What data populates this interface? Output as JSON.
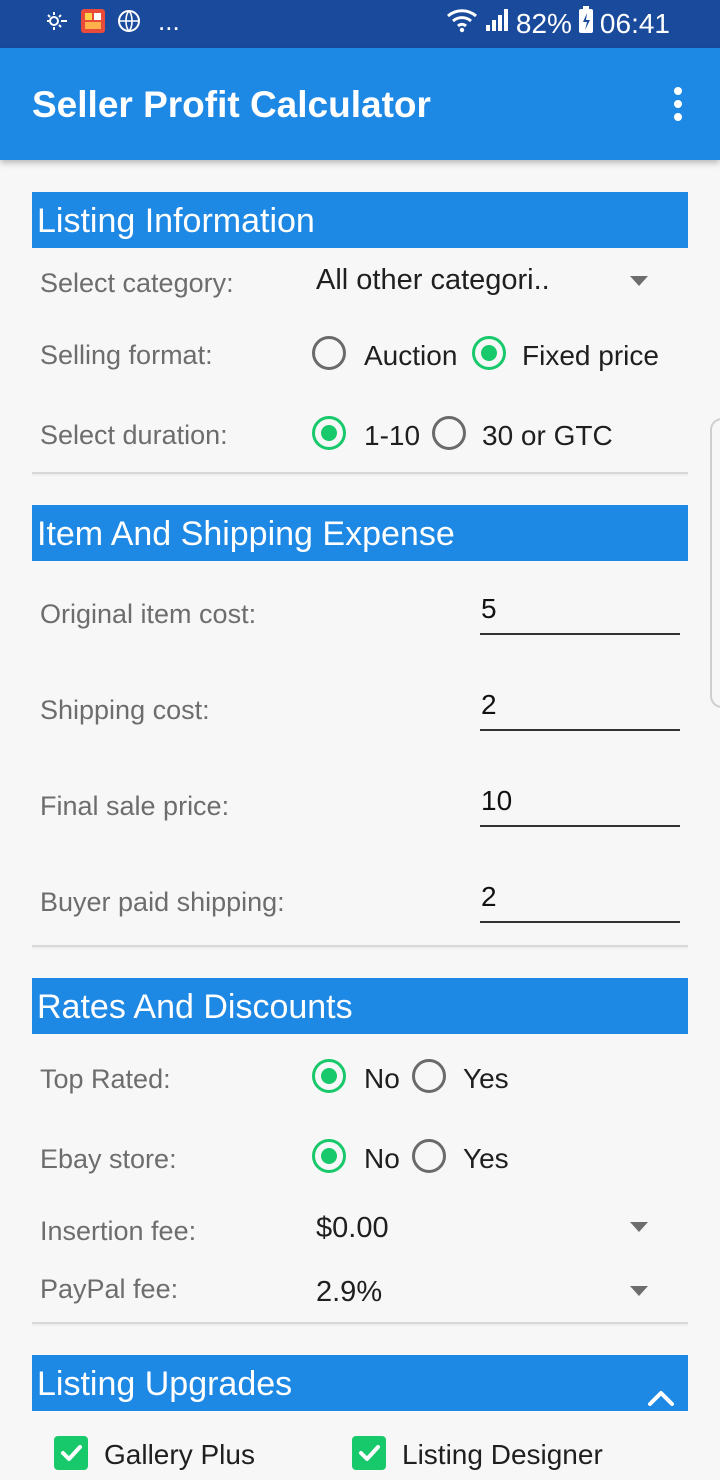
{
  "status_bar": {
    "left_icons": [
      "weather-icon",
      "gallery-icon",
      "globe-icon"
    ],
    "ellipsis": "...",
    "battery": "82%",
    "time": "06:41"
  },
  "app_bar": {
    "title": "Seller Profit Calculator",
    "menu_icon": "more-vert-icon"
  },
  "listing_info": {
    "header": "Listing Information",
    "category_label": "Select category:",
    "category_value": "All other categori..",
    "format_label": "Selling format:",
    "format_options": [
      "Auction",
      "Fixed price"
    ],
    "format_selected": "Fixed price",
    "duration_label": "Select duration:",
    "duration_options": [
      "1-10",
      "30 or GTC"
    ],
    "duration_selected": "1-10"
  },
  "item_shipping": {
    "header": "Item And Shipping Expense",
    "fields": [
      {
        "label": "Original item cost:",
        "value": "5"
      },
      {
        "label": "Shipping cost:",
        "value": "2"
      },
      {
        "label": "Final sale price:",
        "value": "10"
      },
      {
        "label": "Buyer paid shipping:",
        "value": "2"
      }
    ]
  },
  "rates": {
    "header": "Rates And Discounts",
    "top_rated_label": "Top Rated:",
    "top_rated_options": [
      "No",
      "Yes"
    ],
    "top_rated_selected": "No",
    "ebay_store_label": "Ebay store:",
    "ebay_store_options": [
      "No",
      "Yes"
    ],
    "ebay_store_selected": "No",
    "insertion_fee_label": "Insertion fee:",
    "insertion_fee_value": "$0.00",
    "paypal_fee_label": "PayPal fee:",
    "paypal_fee_value": "2.9%"
  },
  "upgrades": {
    "header": "Listing Upgrades",
    "options": [
      {
        "label": "Gallery Plus",
        "checked": true
      },
      {
        "label": "Listing Designer",
        "checked": true
      }
    ]
  },
  "colors": {
    "status_bar": "#1a4a9c",
    "app_bar": "#1e88e5",
    "accent_green": "#17c96a",
    "background": "#f7f7f7"
  }
}
